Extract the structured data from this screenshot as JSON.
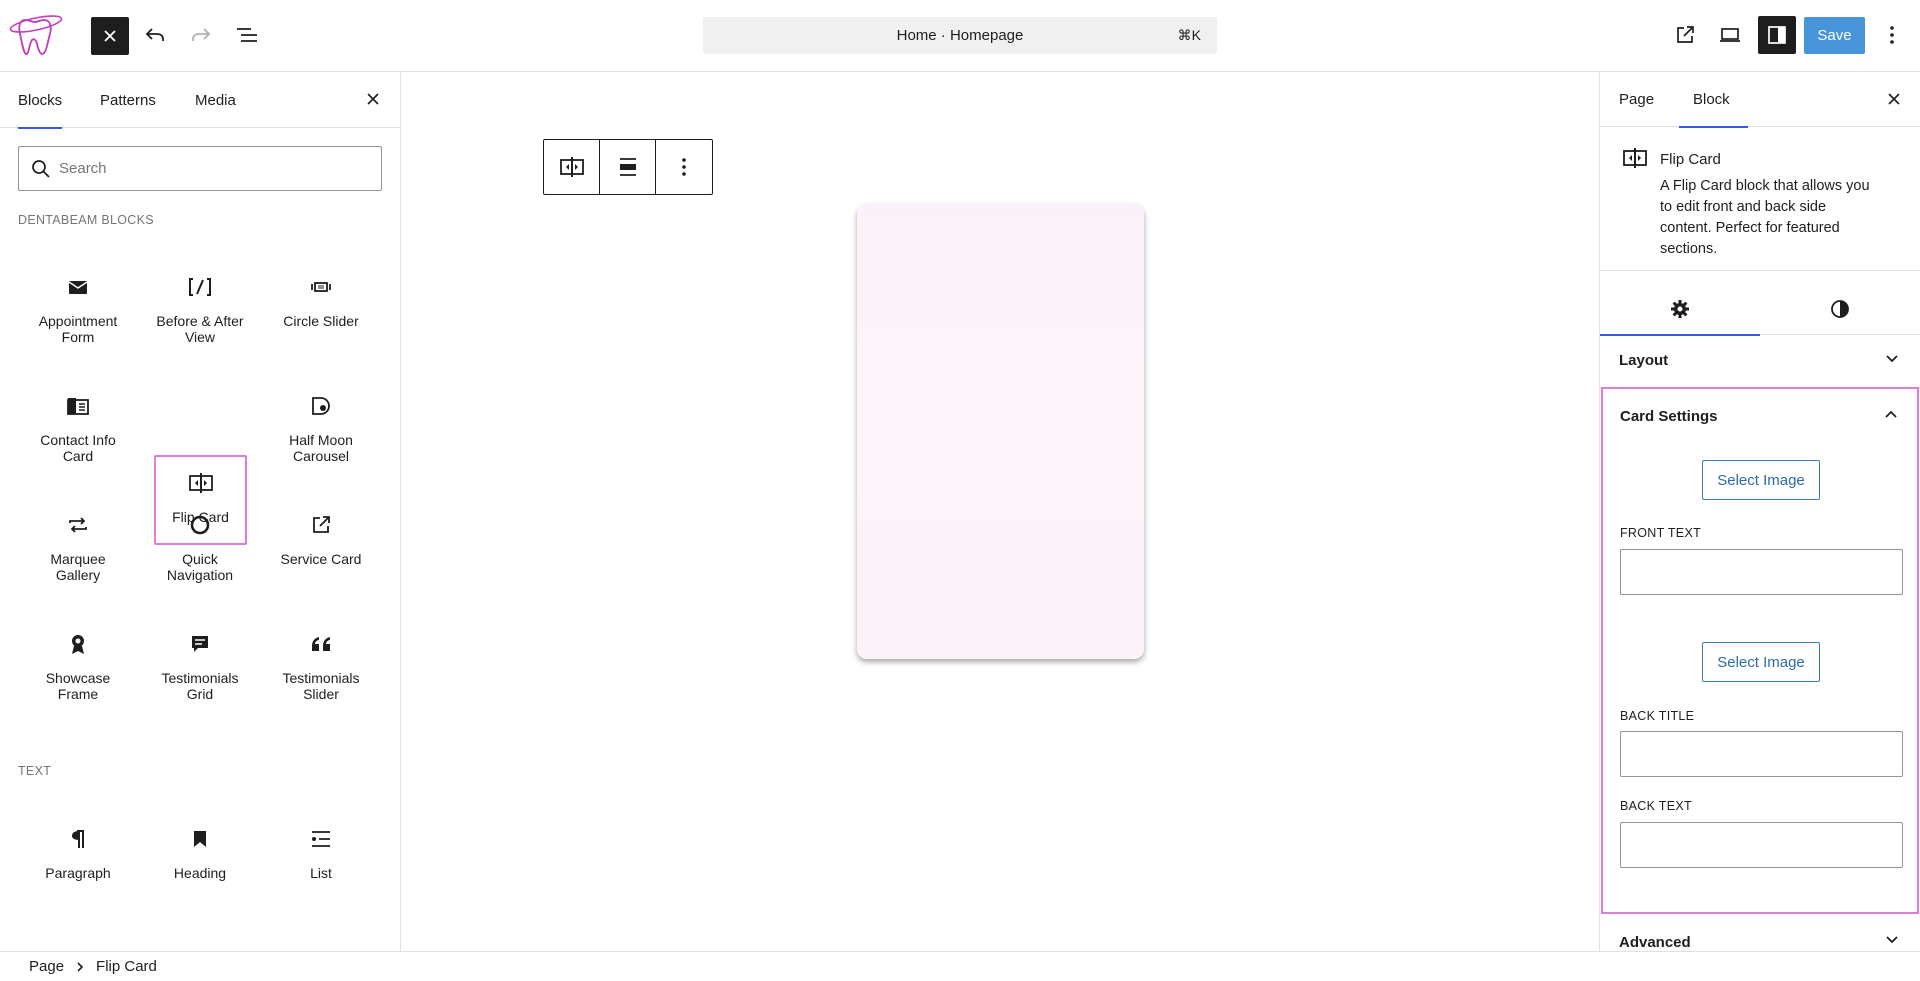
{
  "colors": {
    "accent": "#3858e9",
    "highlight": "#e07bd8",
    "save_button": "#3f8fd6",
    "card_bg": "#fbf1fa"
  },
  "topbar": {
    "command_bar_text": "Home · Homepage",
    "command_shortcut": "⌘K",
    "save_label": "Save"
  },
  "inserter": {
    "tabs": [
      "Blocks",
      "Patterns",
      "Media"
    ],
    "search_placeholder": "Search",
    "categories": [
      {
        "label": "DENTABEAM BLOCKS",
        "blocks": [
          {
            "label": "Appointment Form",
            "icon": "envelope-icon"
          },
          {
            "label": "Before & After View",
            "icon": "before-after-icon"
          },
          {
            "label": "Circle Slider",
            "icon": "slider-icon"
          },
          {
            "label": "Contact Info Card",
            "icon": "contact-card-icon"
          },
          {
            "label": "Flip Card",
            "icon": "flip-icon",
            "selected": true
          },
          {
            "label": "Half Moon Carousel",
            "icon": "half-moon-icon"
          },
          {
            "label": "Marquee Gallery",
            "icon": "repeat-icon"
          },
          {
            "label": "Quick Navigation",
            "icon": "circle-icon"
          },
          {
            "label": "Service Card",
            "icon": "external-link-icon"
          },
          {
            "label": "Showcase Frame",
            "icon": "award-icon"
          },
          {
            "label": "Testimonials Grid",
            "icon": "comment-icon"
          },
          {
            "label": "Testimonials Slider",
            "icon": "quote-icon"
          }
        ]
      },
      {
        "label": "TEXT",
        "blocks": [
          {
            "label": "Paragraph",
            "icon": "paragraph-icon"
          },
          {
            "label": "Heading",
            "icon": "bookmark-icon"
          },
          {
            "label": "List",
            "icon": "list-icon"
          },
          {
            "label": "",
            "icon": "quote-icon"
          },
          {
            "label": "",
            "icon": "code-icon"
          },
          {
            "label": "",
            "icon": "details-icon"
          }
        ]
      }
    ]
  },
  "sidebar": {
    "tabs": [
      "Page",
      "Block"
    ],
    "block_card": {
      "title": "Flip Card",
      "description": "A Flip Card block that allows you to edit front and back side content. Perfect for featured sections."
    },
    "panels": {
      "layout": "Layout",
      "card_settings": "Card Settings",
      "advanced": "Advanced"
    },
    "card_settings": {
      "select_image_label": "Select Image",
      "front_text_label": "FRONT TEXT",
      "front_text_value": "",
      "back_title_label": "BACK TITLE",
      "back_title_value": "",
      "back_text_label": "BACK TEXT",
      "back_text_value": ""
    }
  },
  "footer": {
    "breadcrumb": [
      "Page",
      "Flip Card"
    ]
  }
}
